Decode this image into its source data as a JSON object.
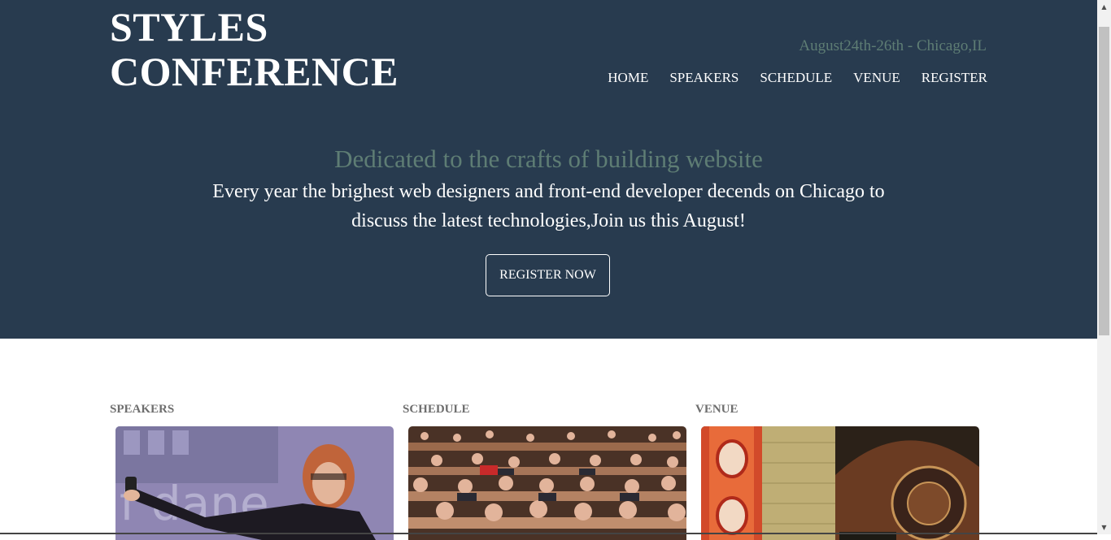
{
  "header": {
    "logo_line1": "STYLES",
    "logo_line2": "CONFERENCE",
    "dateline": "August24th-26th - Chicago,IL",
    "nav": [
      "HOME",
      "SPEAKERS",
      "SCHEDULE",
      "VENUE",
      "REGISTER"
    ]
  },
  "hero": {
    "title": "Dedicated to the crafts of building website",
    "text": "Every year the brighest web designers and front-end developer decends on Chicago to discuss the latest technologies,Join us this August!",
    "button": "REGISTER NOW"
  },
  "sections": [
    {
      "label": "SPEAKERS"
    },
    {
      "label": "SCHEDULE"
    },
    {
      "label": "VENUE"
    }
  ],
  "colors": {
    "hero_bg": "#283b4f",
    "muted_green": "#5e7d74",
    "text_white": "#ffffff",
    "section_label": "#6e6e6e"
  }
}
